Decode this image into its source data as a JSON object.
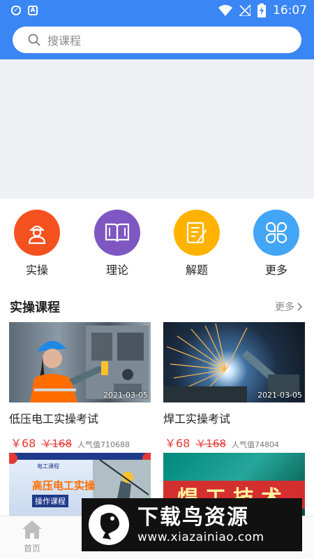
{
  "status": {
    "time": "16:07"
  },
  "search": {
    "placeholder": "搜课程"
  },
  "categories": [
    {
      "label": "实操",
      "color": "#f4511e",
      "icon": "worker-icon"
    },
    {
      "label": "理论",
      "color": "#7e57c2",
      "icon": "book-icon"
    },
    {
      "label": "解题",
      "color": "#ffb300",
      "icon": "notes-icon"
    },
    {
      "label": "更多",
      "color": "#42a5f5",
      "icon": "grid-icon"
    }
  ],
  "section": {
    "title": "实操课程",
    "more": "更多"
  },
  "courses": [
    {
      "name": "低压电工实操考试",
      "date": "2021-03-05",
      "price": "￥68",
      "original": "￥168",
      "popularity": "人气值710688"
    },
    {
      "name": "焊工实操考试",
      "date": "2021-03-05",
      "price": "￥68",
      "original": "￥168",
      "popularity": "人气值74804"
    },
    {
      "thumb_caption_tag": "电工课程",
      "thumb_caption_title": "高压电工实操",
      "thumb_caption_sub": "操作课程"
    },
    {
      "thumb_caption_title": "焊工技术"
    }
  ],
  "tabbar": {
    "home": "首页"
  },
  "watermark": {
    "title": "下载鸟资源",
    "url": "www.xiazainiao.com"
  },
  "colors": {
    "primary": "#3a86f5",
    "price": "#e53935"
  }
}
